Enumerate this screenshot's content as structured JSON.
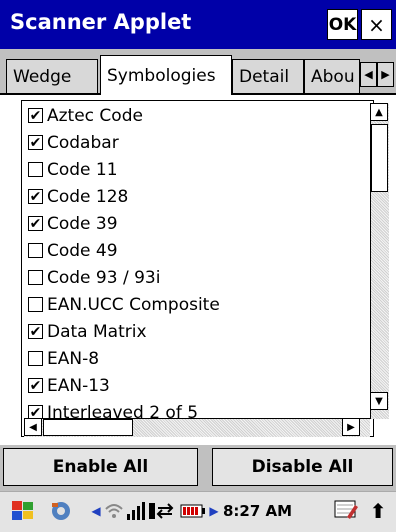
{
  "window": {
    "title": "Scanner Applet",
    "ok_label": "OK",
    "close_label": "×"
  },
  "tabs": [
    {
      "label": "Wedge",
      "active": false
    },
    {
      "label": "Symbologies",
      "active": true
    },
    {
      "label": "Detail",
      "active": false
    },
    {
      "label": "Abou",
      "active": false
    }
  ],
  "symbologies": [
    {
      "label": "Aztec Code",
      "checked": true
    },
    {
      "label": "Codabar",
      "checked": true
    },
    {
      "label": "Code 11",
      "checked": false
    },
    {
      "label": "Code 128",
      "checked": true
    },
    {
      "label": "Code 39",
      "checked": true
    },
    {
      "label": "Code 49",
      "checked": false
    },
    {
      "label": "Code 93 / 93i",
      "checked": false
    },
    {
      "label": "EAN.UCC Composite",
      "checked": false
    },
    {
      "label": "Data Matrix",
      "checked": true
    },
    {
      "label": "EAN-8",
      "checked": false
    },
    {
      "label": "EAN-13",
      "checked": true
    },
    {
      "label": "Interleaved 2 of 5",
      "checked": true
    }
  ],
  "buttons": {
    "enable_all": "Enable All",
    "disable_all": "Disable All"
  },
  "taskbar": {
    "time": "8:27 AM"
  },
  "colors": {
    "titlebar": "#0000a8",
    "window_bg": "#c0c0c0"
  }
}
